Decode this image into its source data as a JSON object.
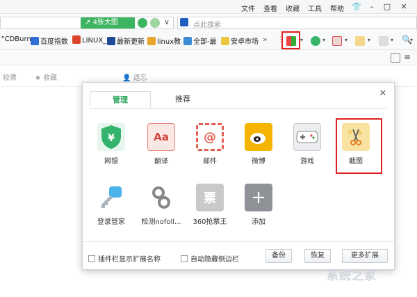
{
  "menubar": {
    "items": [
      "文件",
      "查看",
      "收藏",
      "工具",
      "帮助"
    ]
  },
  "addr": {
    "bigpic_label": "4张大图",
    "search_placeholder": "点此搜索"
  },
  "bookmarks": [
    "\"CDBurn",
    "百度指数",
    "LINUX_",
    "最新更新",
    "linux教",
    "全部-最",
    "安卓市场"
  ],
  "tabs_row": {
    "a": "较票",
    "b": "收藏",
    "c": "遗忘"
  },
  "dialog": {
    "tab_manage": "管理",
    "tab_recommend": "推荐",
    "extensions": [
      "网银",
      "翻译",
      "邮件",
      "微博",
      "游戏",
      "截图",
      "登录管家",
      "检测nofoll...",
      "360抢票王",
      "添加"
    ],
    "chk_names": "插件栏显示扩展名称",
    "chk_sidebar": "自动隐藏侧边栏",
    "btn_backup": "备份",
    "btn_restore": "恢复",
    "btn_more": "更多扩展",
    "icon_glyphs": {
      "aa": "Aa",
      "mail": "@",
      "ticket": "票",
      "plus": "+"
    }
  },
  "watermark": "系统之家",
  "colors": {
    "accent": "#2aa55c",
    "highlight": "#e02020"
  }
}
